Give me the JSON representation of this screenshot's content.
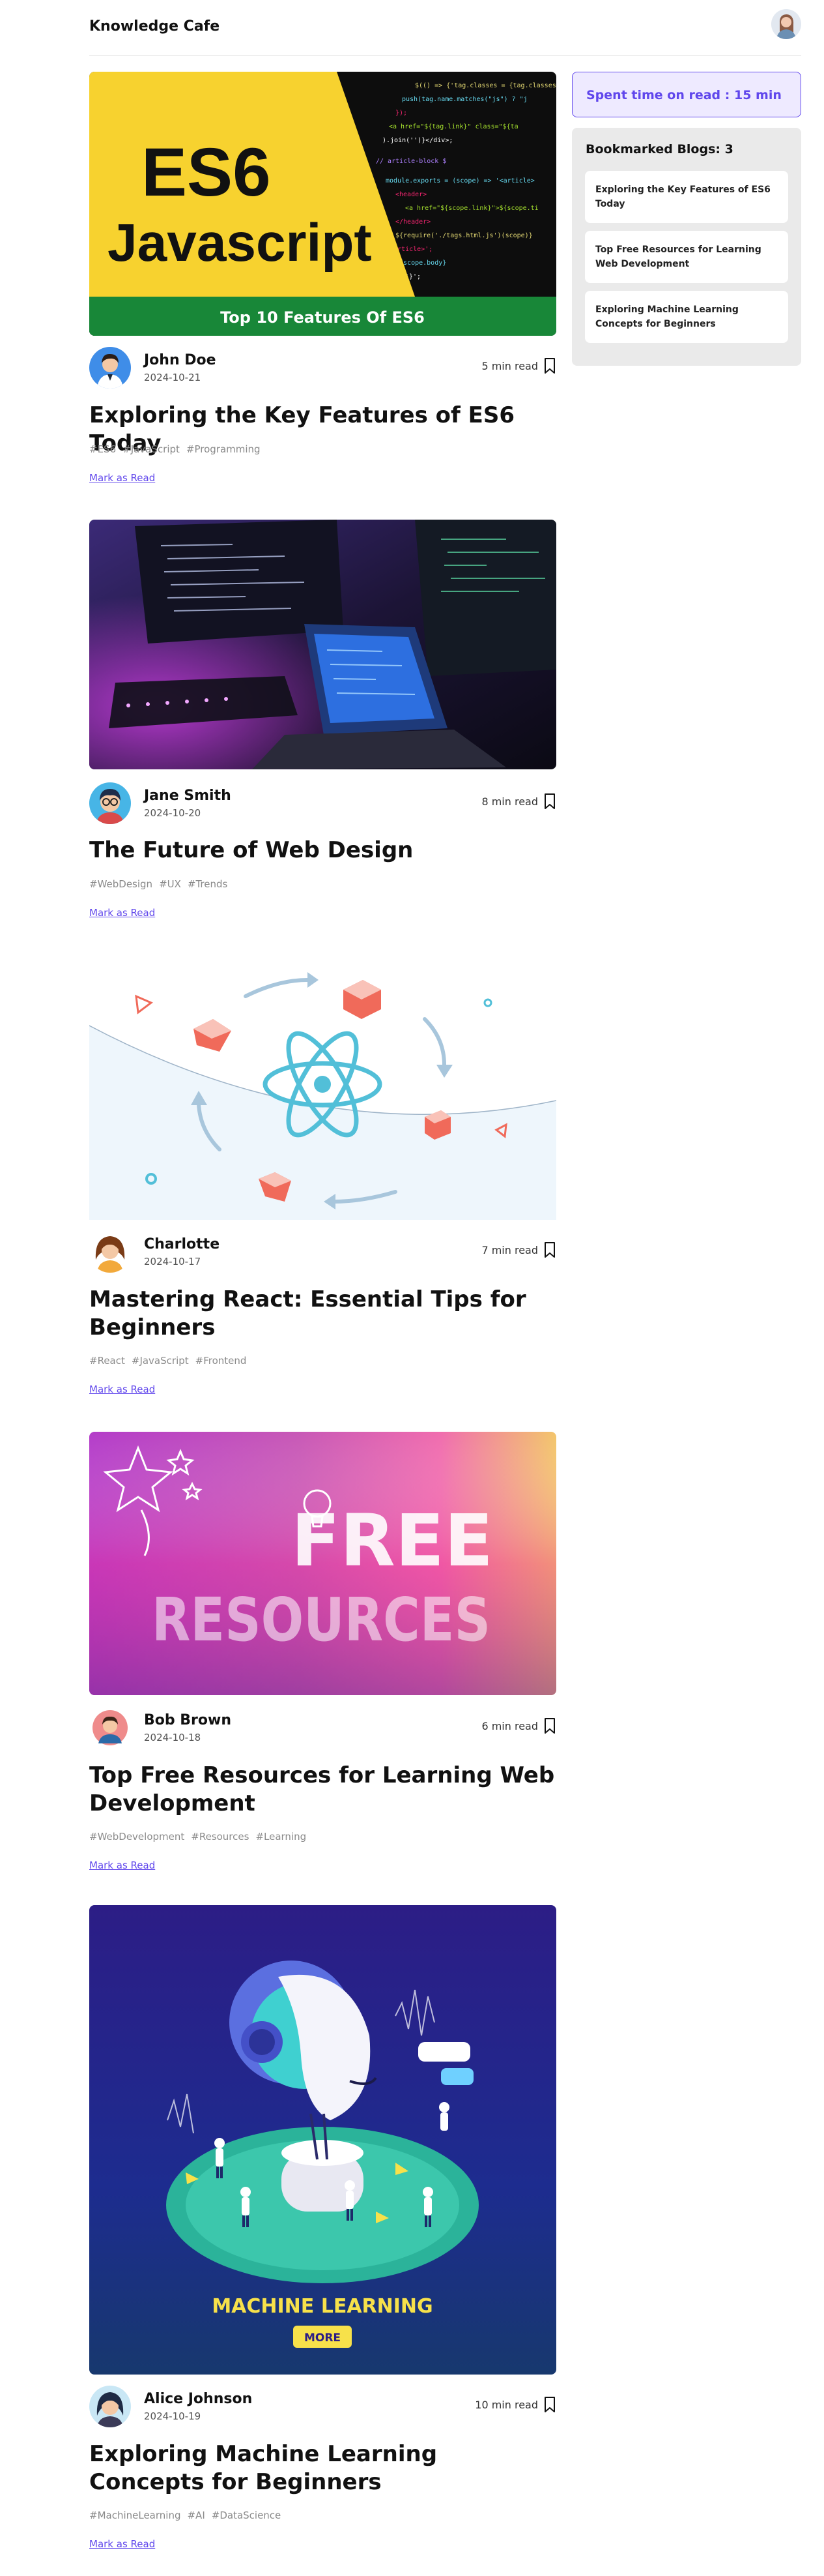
{
  "header": {
    "brand": "Knowledge Cafe",
    "profile_avatar": "user-avatar"
  },
  "posts": [
    {
      "cover_image": "es6-javascript-banner",
      "cover_text": {
        "line1": "ES6",
        "line2": "Javascript",
        "ribbon": "Top 10 Features Of ES6"
      },
      "author": "John Doe",
      "date": "2024-10-21",
      "read_time": "5 min read",
      "title": "Exploring the Key Features of ES6 Today",
      "tags": [
        "#ES6",
        "#JavaScript",
        "#Programming"
      ],
      "mark_label": "Mark as Read",
      "bookmark_icon": "bookmark-icon"
    },
    {
      "cover_image": "dark-desk-laptop-code",
      "author": "Jane Smith",
      "date": "2024-10-20",
      "read_time": "8 min read",
      "title": "The Future of Web Design",
      "tags": [
        "#WebDesign",
        "#UX",
        "#Trends"
      ],
      "mark_label": "Mark as Read",
      "bookmark_icon": "bookmark-icon"
    },
    {
      "cover_image": "react-atom-illustration",
      "author": "Charlotte",
      "date": "2024-10-17",
      "read_time": "7 min read",
      "title": "Mastering React: Essential Tips for Beginners",
      "tags": [
        "#React",
        "#JavaScript",
        "#Frontend"
      ],
      "mark_label": "Mark as Read",
      "bookmark_icon": "bookmark-icon"
    },
    {
      "cover_image": "free-resources-gradient",
      "cover_text": {
        "line1": "FREE",
        "line2": "RESOURCES"
      },
      "author": "Bob Brown",
      "date": "2024-10-18",
      "read_time": "6 min read",
      "title": "Top Free Resources for Learning Web Development",
      "tags": [
        "#WebDevelopment",
        "#Resources",
        "#Learning"
      ],
      "mark_label": "Mark as Read",
      "bookmark_icon": "bookmark-icon"
    },
    {
      "cover_image": "machine-learning-isometric",
      "cover_text": {
        "line1": "MACHINE LEARNING",
        "button": "MORE"
      },
      "author": "Alice Johnson",
      "date": "2024-10-19",
      "read_time": "10 min read",
      "title": "Exploring Machine Learning Concepts for Beginners",
      "tags": [
        "#MachineLearning",
        "#AI",
        "#DataScience"
      ],
      "mark_label": "Mark as Read",
      "bookmark_icon": "bookmark-icon"
    }
  ],
  "sidebar": {
    "spent_time": "Spent time on read : 15 min",
    "bookmarks_title": "Bookmarked Blogs: 3",
    "bookmarks": [
      "Exploring the Key Features of ES6 Today",
      "Top Free Resources for Learning Web Development",
      "Exploring Machine Learning Concepts for Beginners"
    ]
  },
  "colors": {
    "accent": "#6047ec",
    "accent_bg": "#eeeaff",
    "panel_bg": "#eaeaea",
    "es6_yellow": "#f7d22f",
    "es6_green": "#188738"
  }
}
